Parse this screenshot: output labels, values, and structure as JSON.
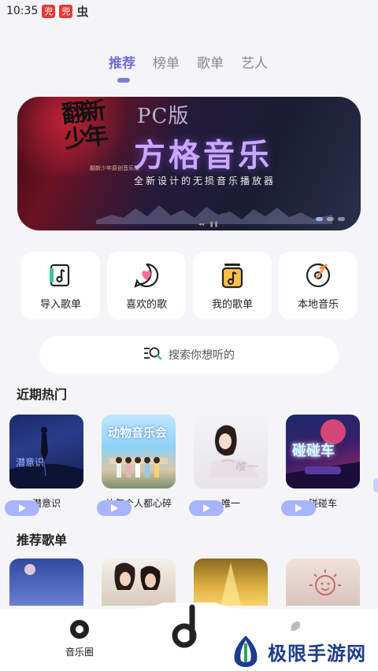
{
  "status_bar": {
    "time": "10:35",
    "badge1": "兜",
    "badge2": "兜",
    "glyph": "虫"
  },
  "tabs": [
    {
      "label": "推荐",
      "active": true
    },
    {
      "label": "榜单",
      "active": false
    },
    {
      "label": "歌单",
      "active": false
    },
    {
      "label": "艺人",
      "active": false
    }
  ],
  "banner": {
    "pc_label": "PC版",
    "title": "方格音乐",
    "subtitle": "全新设计的无损音乐播放器",
    "calligraphy": "翻新少年",
    "small_text": "翻新少年原创音乐集"
  },
  "shortcuts": [
    {
      "label": "导入歌单",
      "icon": "import-playlist-icon"
    },
    {
      "label": "喜欢的歌",
      "icon": "heart-chat-icon"
    },
    {
      "label": "我的歌单",
      "icon": "my-playlist-icon"
    },
    {
      "label": "本地音乐",
      "icon": "disc-icon"
    }
  ],
  "search": {
    "placeholder": "搜索你想听的"
  },
  "sections": {
    "recent": "近期热门",
    "recommended": "推荐歌单"
  },
  "recent_songs": [
    {
      "title": "潜意识"
    },
    {
      "title": "让每个人都心碎"
    },
    {
      "title": "唯一"
    },
    {
      "title": "碰碰车"
    }
  ],
  "album_art": {
    "card1": "潜意识",
    "card2": "动物音乐会",
    "card3": "唯一",
    "card4": "碰碰车"
  },
  "bottom_nav": {
    "left_label": "音乐圈",
    "center_glyph": "d"
  },
  "watermark": {
    "text": "极限手游网"
  },
  "colors": {
    "accent": "#6e6fd8",
    "play_pill": "#a9b4ff",
    "background": "#f5f5f8"
  }
}
